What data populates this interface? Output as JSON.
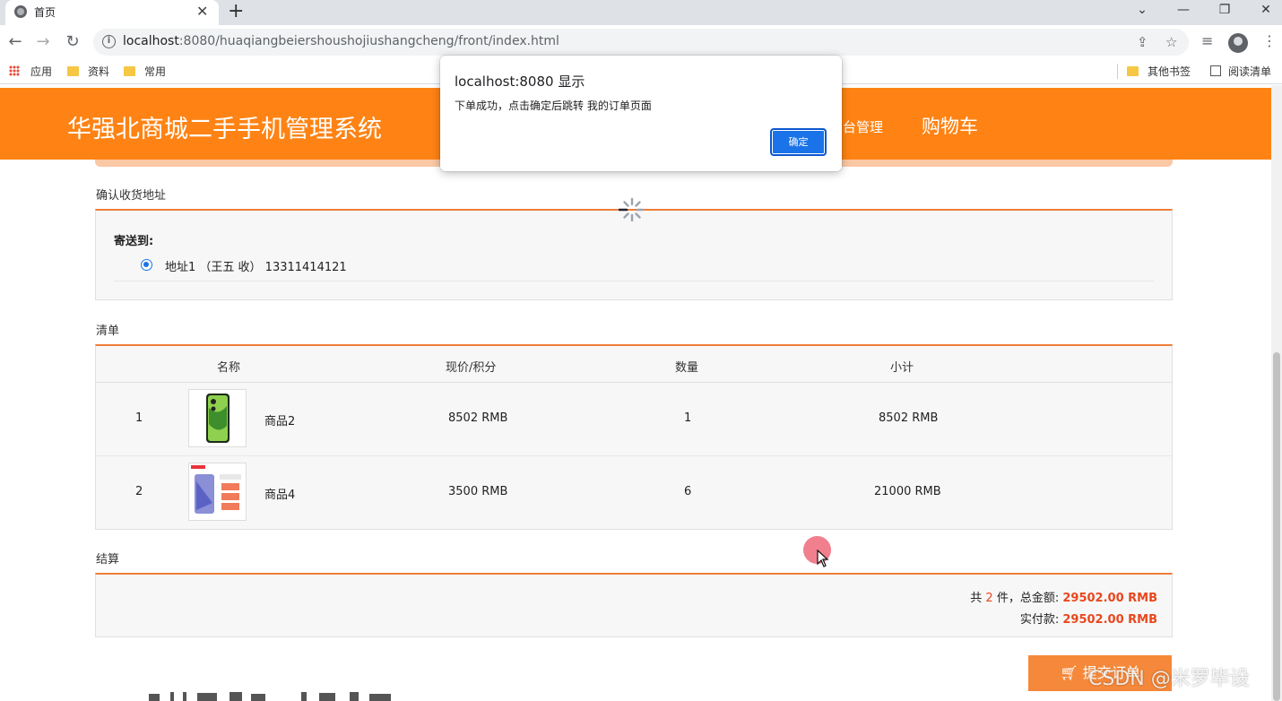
{
  "browser": {
    "tab_title": "首页",
    "tab_close": "✕",
    "new_tab": "+",
    "url_host": "localhost",
    "url_port": ":8080",
    "url_path": "/huaqiangbeiershoushojiushangcheng/front/index.html",
    "window_controls": {
      "menu": "⌄",
      "minimize": "—",
      "restore": "❐",
      "close": "✕"
    },
    "bookmarks": [
      {
        "label": "应用",
        "icon": "apps-grid-icon"
      },
      {
        "label": "资料",
        "icon": "folder-icon"
      },
      {
        "label": "常用",
        "icon": "folder-icon"
      }
    ],
    "bookmarks_right": [
      {
        "label": "其他书签",
        "icon": "folder-icon"
      },
      {
        "label": "阅读清单",
        "icon": "reading-list-icon"
      }
    ]
  },
  "header": {
    "site_title": "华强北商城二手手机管理系统",
    "nav_admin": "台管理",
    "nav_cart": "购物车",
    "accent_color": "#fe8314"
  },
  "address": {
    "section_label": "确认收货地址",
    "ship_to_label": "寄送到:",
    "selected_address": "地址1  （王五 收） 13311414121"
  },
  "list": {
    "section_label": "清单",
    "columns": [
      "名称",
      "现价/积分",
      "数量",
      "小计"
    ],
    "rows": [
      {
        "index": "1",
        "name": "商品2",
        "price": "8502 RMB",
        "qty": "1",
        "subtotal": "8502 RMB"
      },
      {
        "index": "2",
        "name": "商品4",
        "price": "3500 RMB",
        "qty": "6",
        "subtotal": "21000 RMB"
      }
    ]
  },
  "settlement": {
    "section_label": "结算",
    "count_prefix": "共 ",
    "count": "2",
    "count_suffix": " 件，总金额: ",
    "total": "29502.00 RMB",
    "paid_label": "实付款: ",
    "paid": "29502.00 RMB",
    "highlight_color": "#e8471d"
  },
  "submit": {
    "label": "提交订单",
    "icon": "cart-icon"
  },
  "watermark": "CSDN @米罗毕设",
  "dialog": {
    "title": "localhost:8080 显示",
    "message": "下单成功，点击确定后跳转 我的订单页面",
    "ok_label": "确定"
  }
}
